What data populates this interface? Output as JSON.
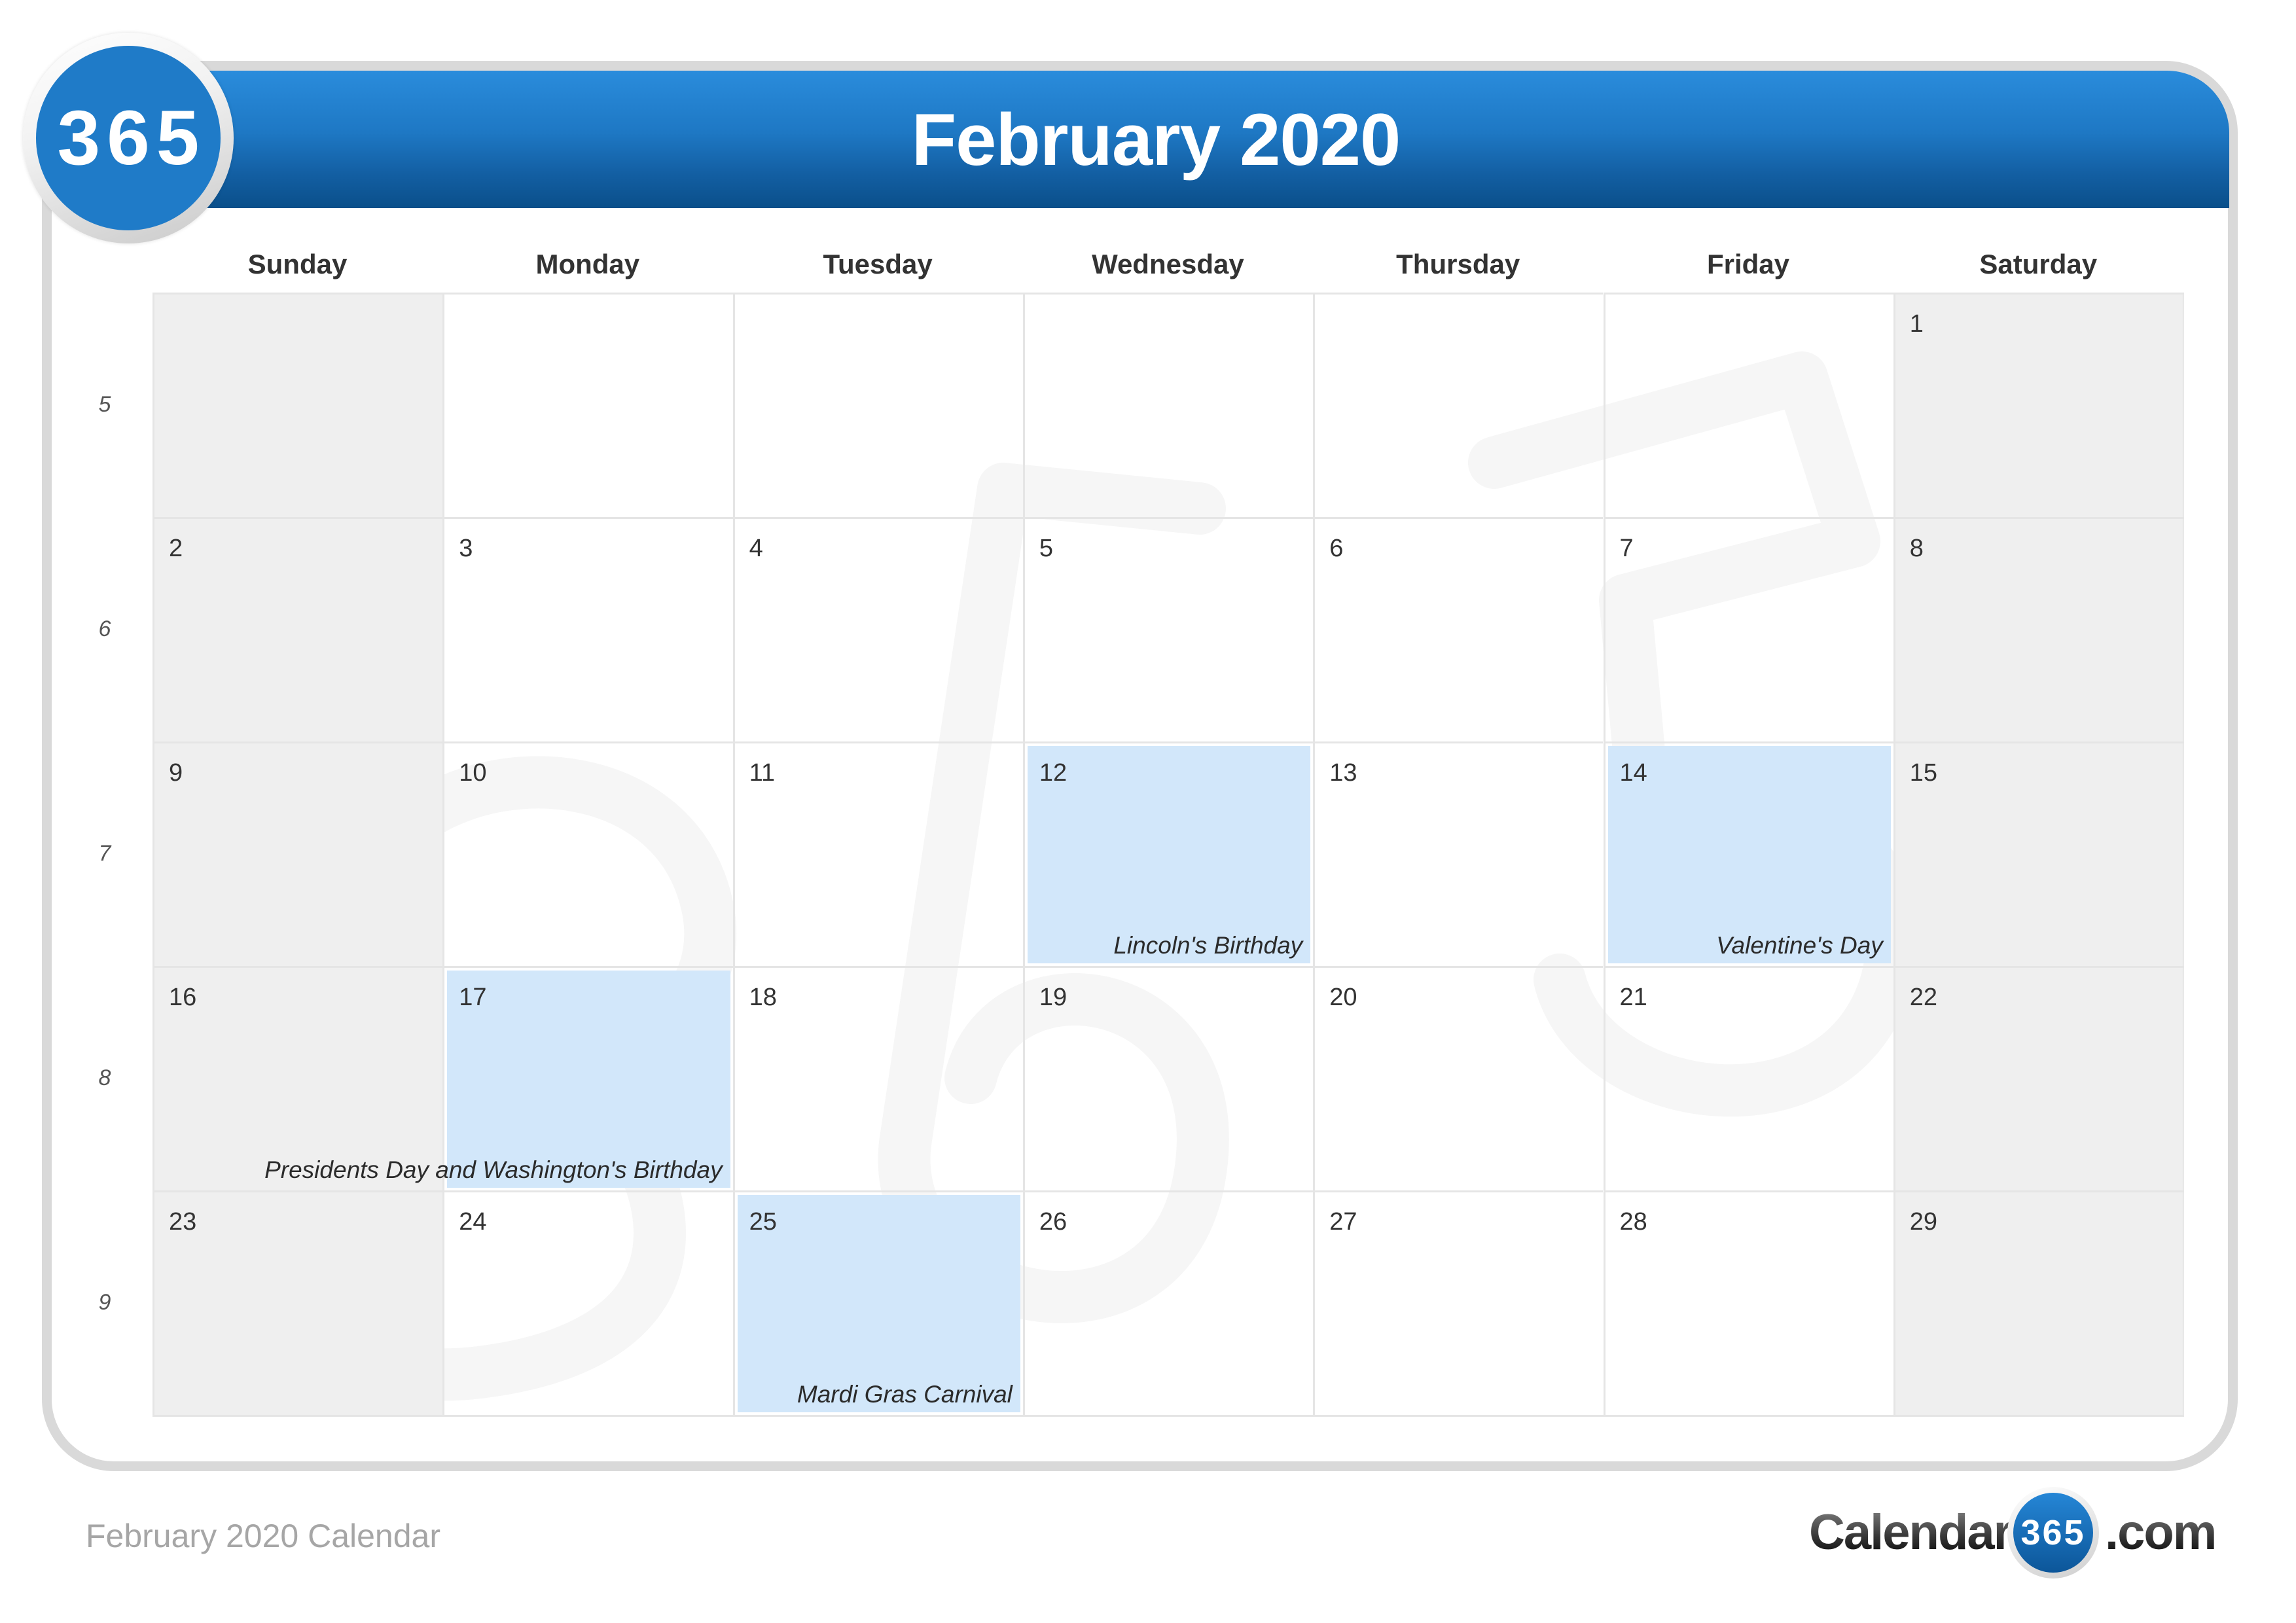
{
  "header": {
    "logo_text": "365",
    "title": "February 2020"
  },
  "weekdays": [
    "Sunday",
    "Monday",
    "Tuesday",
    "Wednesday",
    "Thursday",
    "Friday",
    "Saturday"
  ],
  "week_numbers": [
    "5",
    "6",
    "7",
    "8",
    "9"
  ],
  "weeks": [
    [
      {
        "day": ""
      },
      {
        "day": ""
      },
      {
        "day": ""
      },
      {
        "day": ""
      },
      {
        "day": ""
      },
      {
        "day": ""
      },
      {
        "day": "1"
      }
    ],
    [
      {
        "day": "2"
      },
      {
        "day": "3"
      },
      {
        "day": "4"
      },
      {
        "day": "5"
      },
      {
        "day": "6"
      },
      {
        "day": "7"
      },
      {
        "day": "8"
      }
    ],
    [
      {
        "day": "9"
      },
      {
        "day": "10"
      },
      {
        "day": "11"
      },
      {
        "day": "12",
        "holiday": "Lincoln's Birthday"
      },
      {
        "day": "13"
      },
      {
        "day": "14",
        "holiday": "Valentine's Day"
      },
      {
        "day": "15"
      }
    ],
    [
      {
        "day": "16"
      },
      {
        "day": "17",
        "holiday": "Presidents Day and Washington's Birthday"
      },
      {
        "day": "18"
      },
      {
        "day": "19"
      },
      {
        "day": "20"
      },
      {
        "day": "21"
      },
      {
        "day": "22"
      }
    ],
    [
      {
        "day": "23"
      },
      {
        "day": "24"
      },
      {
        "day": "25",
        "holiday": "Mardi Gras Carnival"
      },
      {
        "day": "26"
      },
      {
        "day": "27"
      },
      {
        "day": "28"
      },
      {
        "day": "29"
      }
    ]
  ],
  "footer": {
    "caption": "February 2020 Calendar",
    "brand_left": "Calendar-",
    "brand_badge": "365",
    "brand_right": ".com"
  },
  "colors": {
    "header_blue": "#1f7bc8",
    "holiday_bg": "#d2e7fa",
    "weekend_bg": "#f0f0f0",
    "frame": "#d9d9d9"
  }
}
